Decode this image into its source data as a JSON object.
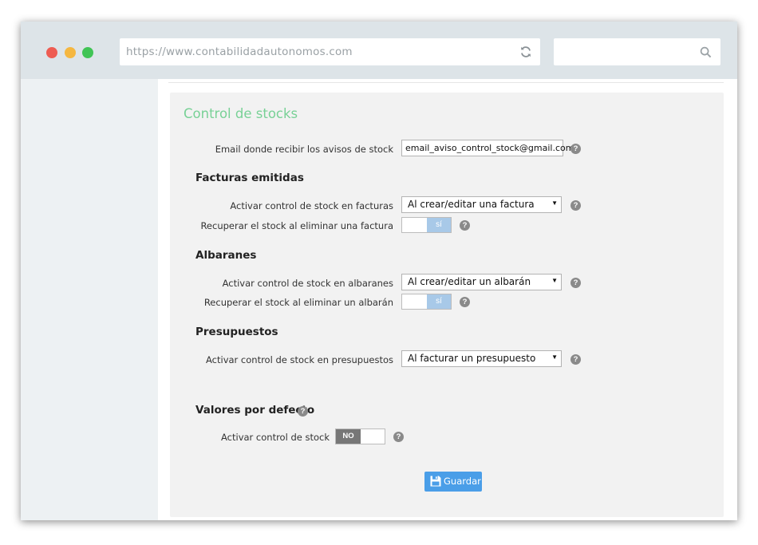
{
  "browser": {
    "url": "https://www.contabilidadautonomos.com",
    "search_value": ""
  },
  "card": {
    "title": "Control de stocks"
  },
  "email_setting": {
    "label": "Email donde recibir los avisos de stock",
    "value": "email_aviso_control_stock@gmail.com"
  },
  "facturas": {
    "heading": "Facturas emitidas",
    "control_label": "Activar control de stock en facturas",
    "control_value": "Al crear/editar una factura",
    "recover_label": "Recuperar el stock al eliminar una factura",
    "recover_toggle": "sí"
  },
  "albaranes": {
    "heading": "Albaranes",
    "control_label": "Activar control de stock en albaranes",
    "control_value": "Al crear/editar un albarán",
    "recover_label": "Recuperar el stock al eliminar un albarán",
    "recover_toggle": "sí"
  },
  "presupuestos": {
    "heading": "Presupuestos",
    "control_label": "Activar control de stock en presupuestos",
    "control_value": "Al facturar un presupuesto"
  },
  "defaults": {
    "heading": "Valores por defecto",
    "control_label": "Activar control de stock",
    "control_toggle": "NO"
  },
  "help_glyph": "?",
  "select_caret": "▼",
  "save_label": "Guardar",
  "colors": {
    "titlebar": "#dde4e8",
    "accent_title": "#78d196",
    "button": "#4a9ee8",
    "toggle_on": "#a8c9e8",
    "toggle_off": "#777777"
  },
  "icons": {
    "reload": "reload-icon",
    "search": "search-icon",
    "help": "help-icon",
    "save": "floppy-disk-icon"
  }
}
